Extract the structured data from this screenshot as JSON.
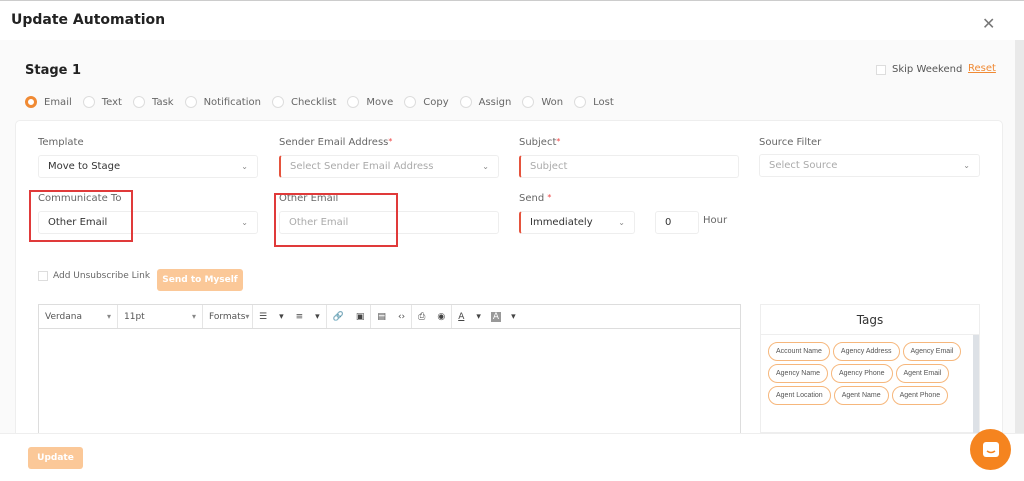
{
  "modal": {
    "title": "Update Automation",
    "close_icon": "close-icon"
  },
  "stage": {
    "title": "Stage 1",
    "skip_weekend": "Skip Weekend",
    "skip_weekend_checked": false,
    "reset": "Reset"
  },
  "actions": [
    {
      "label": "Email",
      "selected": true
    },
    {
      "label": "Text",
      "selected": false
    },
    {
      "label": "Task",
      "selected": false
    },
    {
      "label": "Notification",
      "selected": false
    },
    {
      "label": "Checklist",
      "selected": false
    },
    {
      "label": "Move",
      "selected": false
    },
    {
      "label": "Copy",
      "selected": false
    },
    {
      "label": "Assign",
      "selected": false
    },
    {
      "label": "Won",
      "selected": false
    },
    {
      "label": "Lost",
      "selected": false
    }
  ],
  "form": {
    "template": {
      "label": "Template",
      "value": "Move to Stage"
    },
    "sender": {
      "label": "Sender Email Address",
      "placeholder": "Select Sender Email Address"
    },
    "subject": {
      "label": "Subject",
      "placeholder": "Subject"
    },
    "source": {
      "label": "Source Filter",
      "placeholder": "Select Source"
    },
    "communicate": {
      "label": "Communicate To",
      "value": "Other Email"
    },
    "other_email": {
      "label": "Other Email",
      "placeholder": "Other Email"
    },
    "send": {
      "label": "Send",
      "value": "Immediately",
      "hours": "0",
      "hour_label": "Hour"
    },
    "required_mark": "*",
    "unsubscribe": "Add Unsubscribe Link",
    "send_to_myself": "Send to Myself"
  },
  "editor": {
    "font": "Verdana",
    "size": "11pt",
    "formats": "Formats"
  },
  "tags": {
    "title": "Tags",
    "items": [
      "Account Name",
      "Agency Address",
      "Agency Email",
      "Agency Name",
      "Agency Phone",
      "Agent Email",
      "Agent Location",
      "Agent Name",
      "Agent Phone"
    ]
  },
  "footer": {
    "update": "Update"
  },
  "colors": {
    "accent": "#f08a34",
    "error": "#e5533d",
    "highlight": "#e03a3a"
  }
}
